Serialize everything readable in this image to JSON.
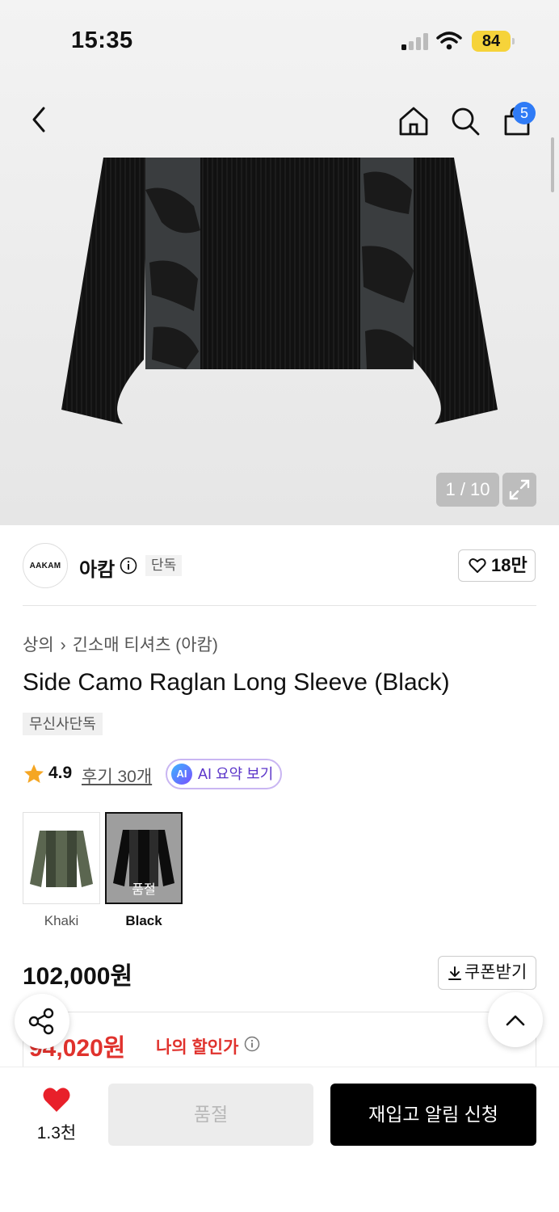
{
  "status_bar": {
    "time": "15:35",
    "battery": "84"
  },
  "nav": {
    "cart_count": "5"
  },
  "gallery": {
    "counter": "1 / 10"
  },
  "brand": {
    "logo_text": "AAKAM",
    "name": "아캄",
    "tag": "단독",
    "likes": "18만"
  },
  "breadcrumb": {
    "category": "상의",
    "subcategory": "긴소매 티셔츠 (아캄)"
  },
  "product": {
    "title": "Side Camo Raglan Long Sleeve (Black)",
    "exclusive_tag": "무신사단독",
    "rating": "4.9",
    "reviews": "후기 30개",
    "ai_summary": "AI 요약 보기",
    "ai_badge": "AI"
  },
  "colors": [
    {
      "label": "Khaki"
    },
    {
      "label": "Black",
      "sold_out": "품절"
    }
  ],
  "price": {
    "original": "102,000원",
    "coupon": "쿠폰받기",
    "discount": "94,020원",
    "discount_label": "나의 할인가"
  },
  "bottom_bar": {
    "wish_count": "1.3천",
    "soldout": "품절",
    "restock": "재입고 알림 신청"
  },
  "colors_theme": {
    "accent_red": "#e0322d",
    "badge_blue": "#2f7bf6",
    "battery_yellow": "#f6d33a"
  }
}
